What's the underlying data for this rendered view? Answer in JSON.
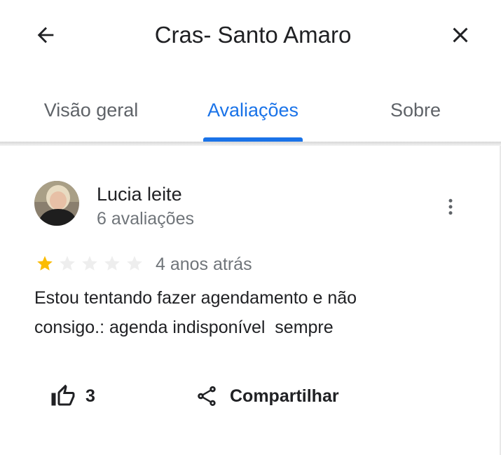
{
  "header": {
    "title": "Cras- Santo Amaro",
    "back_icon": "arrow-back-icon",
    "close_icon": "close-icon"
  },
  "tabs": [
    {
      "label": "Visão geral",
      "active": false
    },
    {
      "label": "Avaliações",
      "active": true
    },
    {
      "label": "Sobre",
      "active": false
    }
  ],
  "review": {
    "author": "Lucia leite",
    "author_meta": "6 avaliações",
    "rating": 1,
    "max_rating": 5,
    "time": "4 anos atrás",
    "text": "Estou tentando fazer agendamento e não\nconsigo.: agenda indisponível  sempre",
    "likes": "3",
    "share_label": "Compartilhar"
  },
  "colors": {
    "accent": "#1a73e8",
    "star_filled": "#fbbc04",
    "star_empty": "#eeeeee",
    "secondary_text": "#70757a"
  }
}
